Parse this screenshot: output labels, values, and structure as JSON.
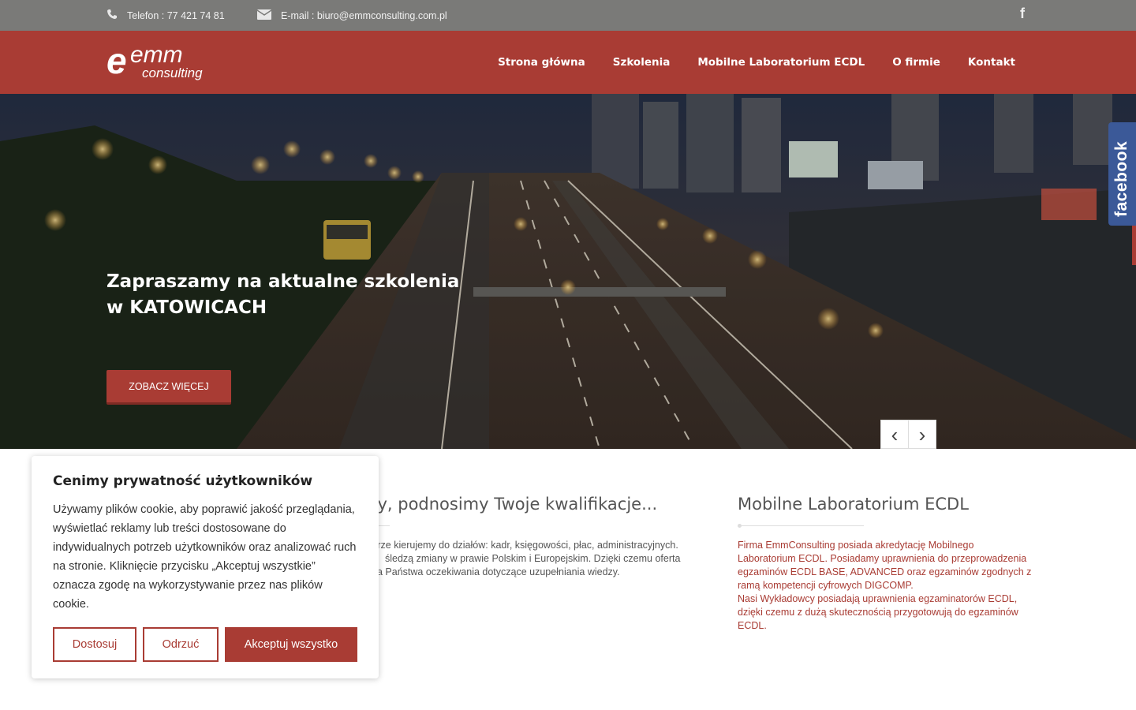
{
  "topbar": {
    "phone": "Telefon : 77 421 74 81",
    "email": "E-mail : biuro@emmconsulting.com.pl",
    "phone_icon": "phone-icon",
    "mail_icon": "envelope-icon",
    "social_icon": "facebook-icon"
  },
  "header": {
    "logo_main": "emm",
    "logo_sub": "consulting",
    "nav": [
      "Strona główna",
      "Szkolenia",
      "Mobilne Laboratorium ECDL",
      "O firmie",
      "Kontakt"
    ]
  },
  "hero": {
    "title": "Zapraszamy na aktualne szkolenia w KATOWICACH",
    "button": "ZOBACZ WIĘCEJ",
    "prev": "‹",
    "next": "›"
  },
  "side_tab": {
    "label": "facebook"
  },
  "content": {
    "col2_title": "my, podnosimy Twoje kwalifikacje...",
    "col2_lines": [
      "j mierze kierujemy do działów: kadr, księgowości, płac, administracyjnych.",
      "śledzą zmiany w prawie Polskim i Europejskim. Dzięki czemu oferta",
      "a Państwa oczekiwania dotyczące uzupełniania wiedzy."
    ],
    "col3_title": "Mobilne Laboratorium ECDL",
    "col3_text": "Firma EmmConsulting posiada akredytację Mobilnego Laboratorium ECDL. Posiadamy uprawnienia do przeprowadzenia egzaminów ECDL BASE, ADVANCED oraz egzaminów zgodnych z ramą kompetencji cyfrowych DIGCOMP.",
    "col3_text2": "Nasi Wykładowcy posiadają uprawnienia egzaminatorów ECDL, dzięki czemu z dużą skutecznością przygotowują do egzaminów ECDL."
  },
  "cookie": {
    "title": "Cenimy prywatność użytkowników",
    "text": "Używamy plików cookie, aby poprawić jakość przeglądania, wyświetlać reklamy lub treści dostosowane do indywidualnych potrzeb użytkowników oraz analizować ruch na stronie. Kliknięcie przycisku „Akceptuj wszystkie” oznacza zgodę na wykorzystywanie przez nas plików cookie.",
    "customize": "Dostosuj",
    "reject": "Odrzuć",
    "accept": "Akceptuj wszystko"
  },
  "colors": {
    "brand": "#a93c34",
    "topbar": "#7a7a78",
    "facebook": "#3b5998"
  }
}
